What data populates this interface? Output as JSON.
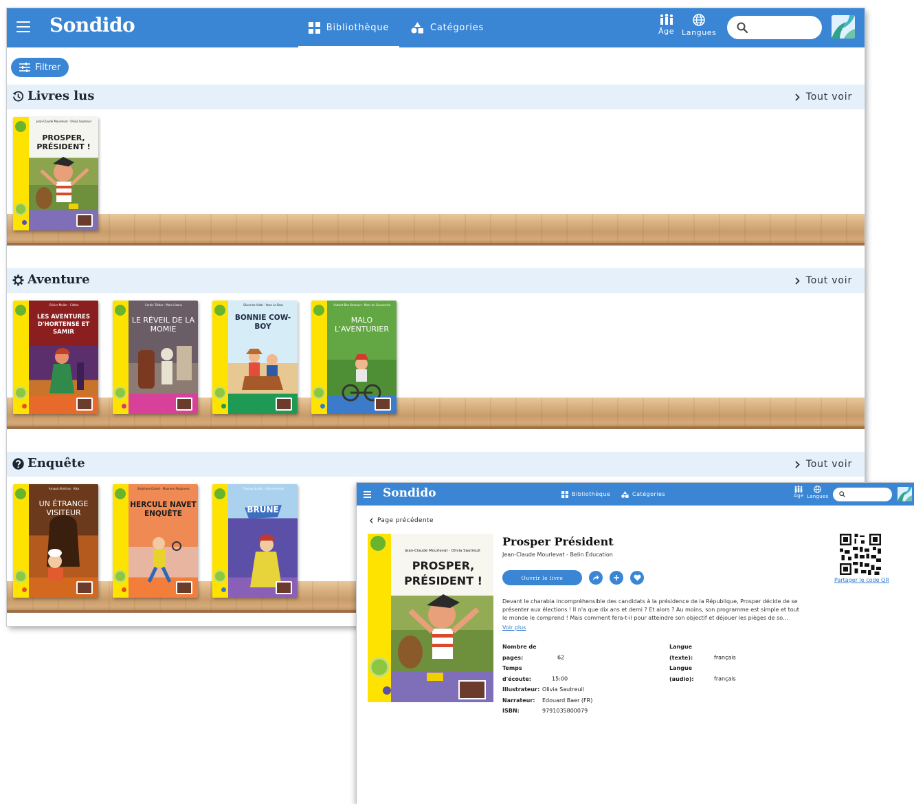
{
  "main": {
    "header": {
      "logo": "Sondido",
      "tabs": [
        {
          "label": "Bibliothèque",
          "icon": "grid-icon",
          "active": true
        },
        {
          "label": "Catégories",
          "icon": "shapes-icon",
          "active": false
        }
      ],
      "age_label": "Âge",
      "langues_label": "Langues",
      "search_placeholder": ""
    },
    "filter_label": "Filtrer",
    "sections": [
      {
        "title": "Livres lus",
        "icon": "history-icon",
        "link": "Tout voir",
        "books": [
          {
            "title": "PROSPER, PRÉSIDENT !",
            "authors": "Jean-Claude Mourlevat · Olivia Sautreuil"
          }
        ]
      },
      {
        "title": "Aventure",
        "icon": "gear-icon",
        "link": "Tout voir",
        "books": [
          {
            "title": "LES AVENTURES D'HORTENSE ET SAMIR",
            "authors": "Olivier Muller · Clotka"
          },
          {
            "title": "LE RÉVEIL DE LA MOMIE",
            "authors": "Carole Trébor · Marc Lizano"
          },
          {
            "title": "BONNIE COW-BOY",
            "authors": "Séverine Vidal · Yann Le Bras"
          },
          {
            "title": "MALO L'AVENTURIER",
            "authors": "Hubert Ben Kemoun · Marc de Gouvenain"
          }
        ]
      },
      {
        "title": "Enquête",
        "icon": "question-icon",
        "link": "Tout voir",
        "books": [
          {
            "title": "UN ÉTRANGE VISITEUR",
            "authors": "Arnaud Alméras · Aiko"
          },
          {
            "title": "HERCULE NAVET ENQUÊTE",
            "authors": "Stéphane Daniel · Maureen Poignonec"
          },
          {
            "title": "BRUNE",
            "authors": "Thomas Scotto · Cléo Germain"
          }
        ]
      }
    ]
  },
  "detail": {
    "header": {
      "logo": "Sondido",
      "tabs": [
        {
          "label": "Bibliothèque"
        },
        {
          "label": "Catégories"
        }
      ],
      "age_label": "Âge",
      "langues_label": "Langues"
    },
    "back_label": "Page précédente",
    "title": "Prosper Président",
    "subtitle": "Jean-Claude Mourlevat - Belin Éducation",
    "open_label": "Ouvrir le livre",
    "description": "Devant le charabia incompréhensible des candidats à la présidence de la République, Prosper décide de se présenter aux élections ! Il n'a que dix ans et demi ? Et alors ? Au moins, son programme est simple et tout le monde le comprend ! Mais comment fera-t-il pour atteindre son objectif et déjouer les pièges de so...",
    "voir_plus": "Voir plus",
    "meta_left": [
      {
        "key": "Nombre de pages:",
        "value": "62"
      },
      {
        "key": "Temps d'écoute:",
        "value": "15:00"
      },
      {
        "key": "Illustrateur:",
        "value": "Olivia Sautreuil"
      },
      {
        "key": "Narrateur:",
        "value": "Edouard Baer (FR)"
      },
      {
        "key": "ISBN:",
        "value": "9791035800079"
      }
    ],
    "meta_right": [
      {
        "key": "Langue (texte):",
        "value": "français"
      },
      {
        "key": "Langue (audio):",
        "value": "français"
      }
    ],
    "qr_label": "Partager le code QR",
    "cover": {
      "title": "PROSPER, PRÉSIDENT !",
      "authors": "Jean-Claude Mourlevat · Olivia Sautreuil"
    }
  },
  "colors": {
    "brand": "#3a86d4",
    "section_bg": "#e5f0fb",
    "spine": "#ffe300",
    "link": "#2e7bd0"
  }
}
